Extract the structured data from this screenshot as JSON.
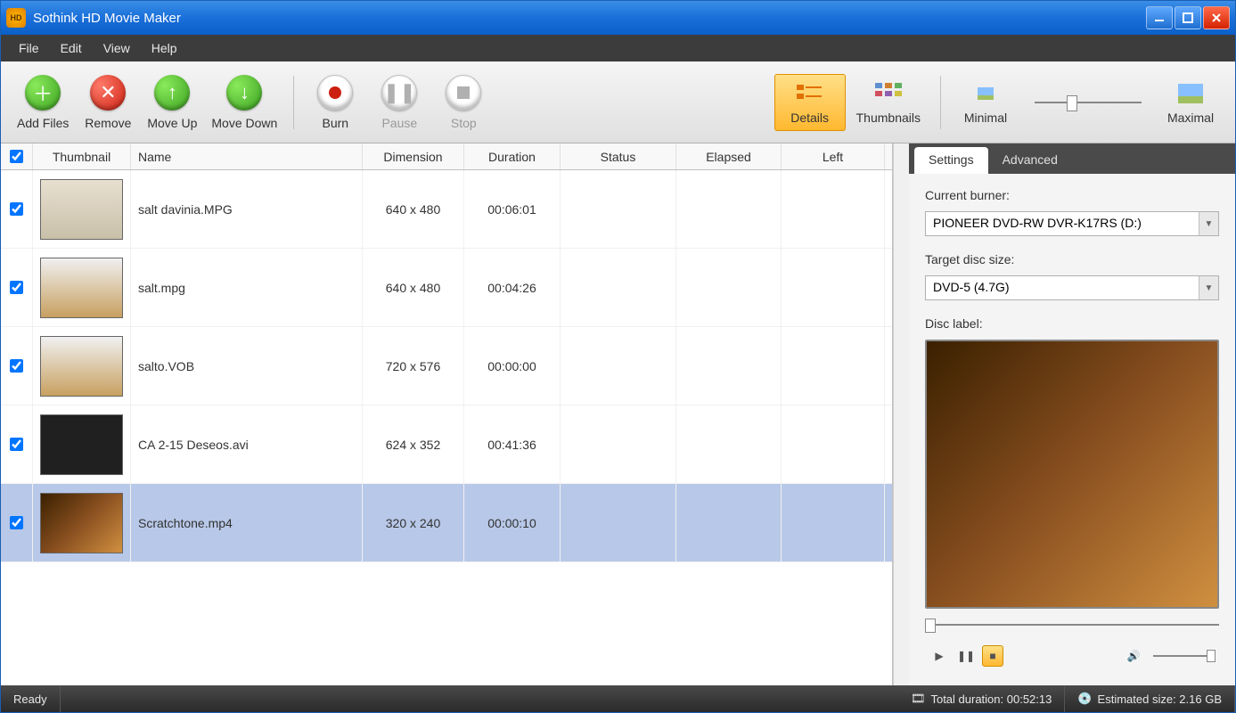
{
  "app": {
    "title": "Sothink HD Movie Maker"
  },
  "menu": {
    "file": "File",
    "edit": "Edit",
    "view": "View",
    "help": "Help"
  },
  "toolbar": {
    "add_files": "Add Files",
    "remove": "Remove",
    "move_up": "Move Up",
    "move_down": "Move Down",
    "burn": "Burn",
    "pause": "Pause",
    "stop": "Stop",
    "details": "Details",
    "thumbnails": "Thumbnails",
    "minimal": "Minimal",
    "maximal": "Maximal"
  },
  "columns": {
    "thumbnail": "Thumbnail",
    "name": "Name",
    "dimension": "Dimension",
    "duration": "Duration",
    "status": "Status",
    "elapsed": "Elapsed",
    "left": "Left"
  },
  "rows": [
    {
      "checked": true,
      "name": "salt davinia.MPG",
      "dimension": "640 x 480",
      "duration": "00:06:01",
      "selected": false,
      "thumb_bg": "linear-gradient(#e8e0d0,#c8c0a8)"
    },
    {
      "checked": true,
      "name": "salt.mpg",
      "dimension": "640 x 480",
      "duration": "00:04:26",
      "selected": false,
      "thumb_bg": "linear-gradient(#f0f0f0,#c8a060)"
    },
    {
      "checked": true,
      "name": "salto.VOB",
      "dimension": "720 x 576",
      "duration": "00:00:00",
      "selected": false,
      "thumb_bg": "linear-gradient(#f0f0f0,#c8a060)"
    },
    {
      "checked": true,
      "name": "CA 2-15 Deseos.avi",
      "dimension": "624 x 352",
      "duration": "00:41:36",
      "selected": false,
      "thumb_bg": "#202020"
    },
    {
      "checked": true,
      "name": "Scratchtone.mp4",
      "dimension": "320 x 240",
      "duration": "00:00:10",
      "selected": true,
      "thumb_bg": "linear-gradient(135deg,#3a2000,#8a5020,#d09040)"
    }
  ],
  "right": {
    "tab_settings": "Settings",
    "tab_advanced": "Advanced",
    "burner_label": "Current burner:",
    "burner_value": "PIONEER DVD-RW DVR-K17RS (D:)",
    "disc_size_label": "Target disc size:",
    "disc_size_value": "DVD-5 (4.7G)",
    "disc_label_label": "Disc label:"
  },
  "status": {
    "ready": "Ready",
    "total_duration": "Total duration: 00:52:13",
    "estimated_size": "Estimated size: 2.16 GB"
  }
}
